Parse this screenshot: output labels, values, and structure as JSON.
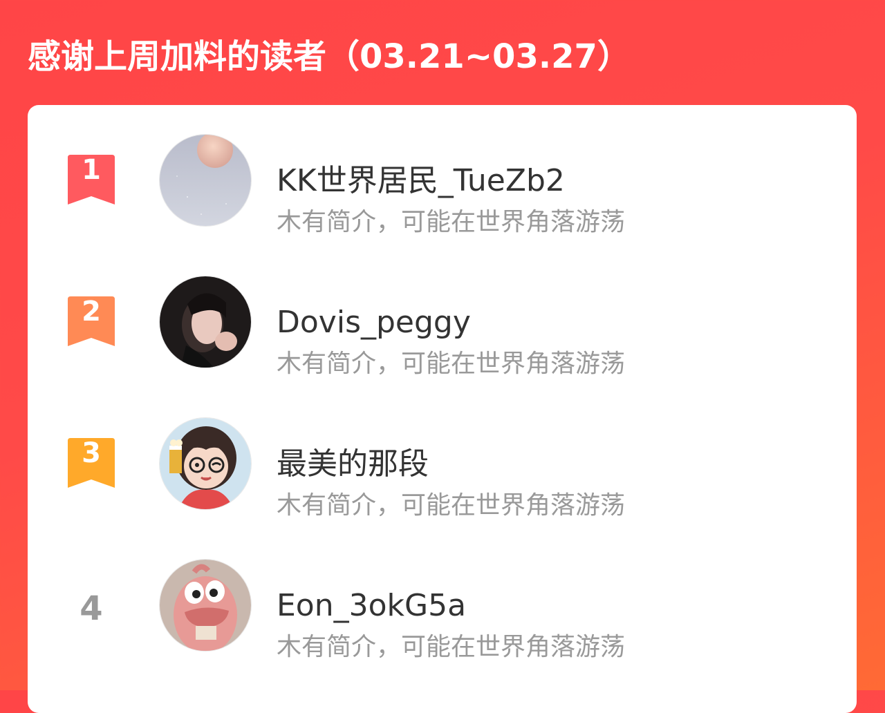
{
  "header": {
    "title": "感谢上周加料的读者（03.21~03.27）"
  },
  "colors": {
    "background_start": "#ff4547",
    "background_end": "#ff6a35",
    "rank1": "#ff5a5f",
    "rank2": "#ff8a55",
    "rank3": "#ffa92a",
    "rank_other": "#999999",
    "name_text": "#333333",
    "desc_text": "#999999"
  },
  "readers": [
    {
      "rank": "1",
      "name": "KK世界居民_TueZb2",
      "desc": "木有简介，可能在世界角落游荡",
      "avatar": "moon-sky-avatar"
    },
    {
      "rank": "2",
      "name": "Dovis_peggy",
      "desc": "木有简介，可能在世界角落游荡",
      "avatar": "portrait-photo-avatar"
    },
    {
      "rank": "3",
      "name": "最美的那段",
      "desc": "木有简介，可能在世界角落游荡",
      "avatar": "cartoon-girl-avatar"
    },
    {
      "rank": "4",
      "name": "Eon_3okG5a",
      "desc": "木有简介，可能在世界角落游荡",
      "avatar": "pink-creature-avatar"
    }
  ]
}
